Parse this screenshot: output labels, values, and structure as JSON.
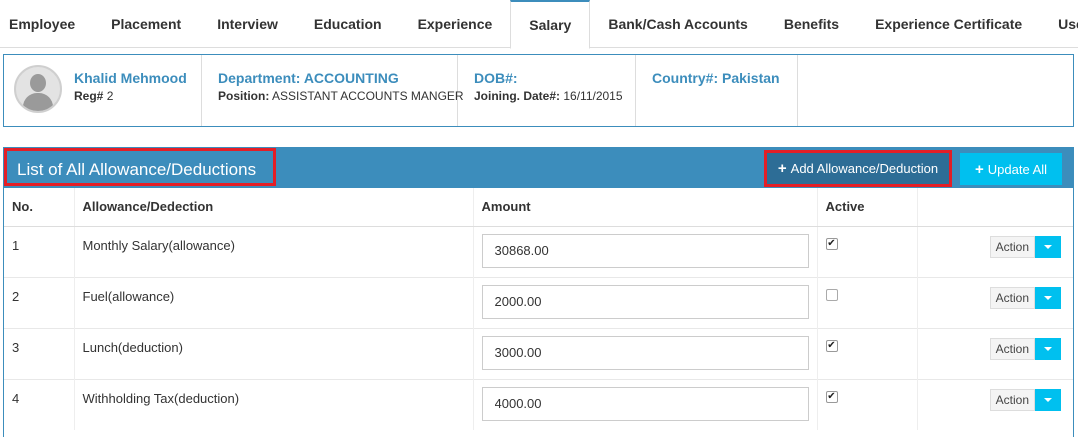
{
  "tabs": [
    "Employee",
    "Placement",
    "Interview",
    "Education",
    "Experience",
    "Salary",
    "Bank/Cash Accounts",
    "Benefits",
    "Experience Certificate",
    "Users"
  ],
  "active_tab": "Salary",
  "employee": {
    "name": "Khalid Mehmood",
    "reg_label": "Reg#",
    "reg_value": "2",
    "department": "Department: ACCOUNTING",
    "position_label": "Position:",
    "position_value": "ASSISTANT ACCOUNTS MANGER",
    "dob": "DOB#:",
    "joining_label": "Joining. Date#:",
    "joining_value": "16/11/2015",
    "country": "Country#: Pakistan"
  },
  "panel": {
    "title": "List of All Allowance/Deductions",
    "add_button": "Add Allowance/Deduction",
    "update_button": "Update All"
  },
  "table": {
    "headers": [
      "No.",
      "Allowance/Dedection",
      "Amount",
      "Active",
      ""
    ],
    "rows": [
      {
        "no": "1",
        "name": "Monthly Salary(allowance)",
        "amount": "30868.00",
        "active": true,
        "action": "Action"
      },
      {
        "no": "2",
        "name": "Fuel(allowance)",
        "amount": "2000.00",
        "active": false,
        "action": "Action"
      },
      {
        "no": "3",
        "name": "Lunch(deduction)",
        "amount": "3000.00",
        "active": true,
        "action": "Action"
      },
      {
        "no": "4",
        "name": "Withholding Tax(deduction)",
        "amount": "4000.00",
        "active": true,
        "action": "Action"
      }
    ]
  },
  "colors": {
    "primary": "#3c8dbc",
    "info": "#00c0ef",
    "highlight": "#e41e26"
  }
}
